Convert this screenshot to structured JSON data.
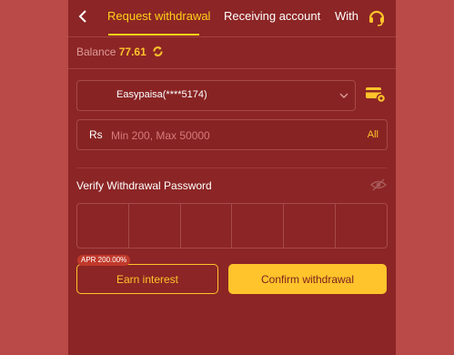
{
  "header": {
    "tabs": [
      {
        "label": "Request withdrawal",
        "active": true
      },
      {
        "label": "Receiving account",
        "active": false
      },
      {
        "label": "With",
        "active": false
      }
    ]
  },
  "balance": {
    "label": "Balance",
    "value": "77.61"
  },
  "account_select": {
    "value": "Easypaisa(****5174)"
  },
  "amount": {
    "currency": "Rs",
    "placeholder": "Min 200, Max 50000",
    "all_label": "All"
  },
  "password": {
    "label": "Verify Withdrawal Password"
  },
  "apr_badge": "APR 200.00%",
  "buttons": {
    "earn": "Earn interest",
    "confirm": "Confirm withdrawal"
  },
  "colors": {
    "accent": "#ffc42b",
    "panel": "#8c2525",
    "background": "#b94a48"
  }
}
